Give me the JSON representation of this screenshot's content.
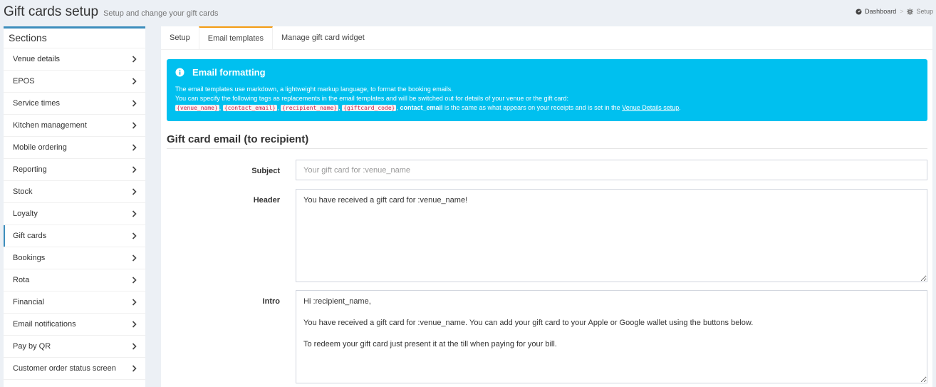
{
  "header": {
    "title": "Gift cards setup",
    "subtitle": "Setup and change your gift cards"
  },
  "breadcrumb": {
    "items": [
      {
        "label": "Dashboard",
        "icon": "dashboard-icon"
      },
      {
        "label": "Setup",
        "icon": "gear-icon"
      }
    ],
    "separator": ">"
  },
  "sidebar": {
    "heading": "Sections",
    "items": [
      {
        "label": "Venue details"
      },
      {
        "label": "EPOS"
      },
      {
        "label": "Service times"
      },
      {
        "label": "Kitchen management"
      },
      {
        "label": "Mobile ordering"
      },
      {
        "label": "Reporting"
      },
      {
        "label": "Stock"
      },
      {
        "label": "Loyalty"
      },
      {
        "label": "Gift cards",
        "active": true
      },
      {
        "label": "Bookings"
      },
      {
        "label": "Rota"
      },
      {
        "label": "Financial"
      },
      {
        "label": "Email notifications"
      },
      {
        "label": "Pay by QR"
      },
      {
        "label": "Customer order status screen"
      }
    ]
  },
  "tabs": [
    {
      "label": "Setup"
    },
    {
      "label": "Email templates",
      "active": true
    },
    {
      "label": "Manage gift card widget"
    }
  ],
  "callout": {
    "title": "Email formatting",
    "line1": "The email templates use markdown, a lightweight markup language, to format the booking emails.",
    "line2": "You can specify the following tags as replacements in the email templates and will be switched out for details of your venue or the gift card:",
    "tags": [
      "{venue_name}",
      "{contact_email}",
      "{recipient_name}",
      "{giftcard_code}"
    ],
    "tag_separator": ",",
    "contact_email_bold": "contact_email",
    "line3_rest": "is the same as what appears on your receipts and is set in the",
    "link_label": "Venue Details setup",
    "line3_end": "."
  },
  "section": {
    "title": "Gift card email (to recipient)"
  },
  "form": {
    "subject_label": "Subject",
    "subject_placeholder": "Your gift card for :venue_name",
    "header_label": "Header",
    "header_value": "You have received a gift card for :venue_name!",
    "intro_label": "Intro",
    "intro_value": "Hi :recipient_name,\n\nYou have received a gift card for :venue_name. You can add your gift card to your Apple or Google wallet using the buttons below.\n\nTo redeem your gift card just present it at the till when paying for your bill."
  },
  "colors": {
    "callout_bg": "#00c0ef",
    "active_tab_accent": "#f39c12",
    "sidebar_accent": "#3c8dbc",
    "tag_text": "#c7254e"
  }
}
